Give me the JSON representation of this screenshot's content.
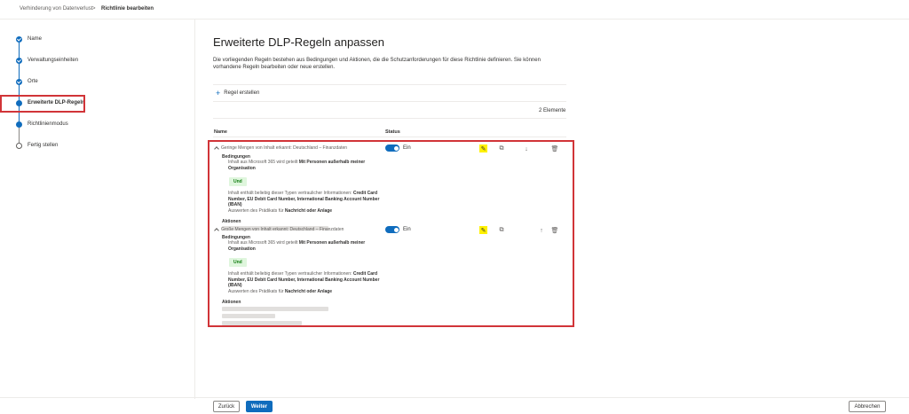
{
  "breadcrumb": {
    "parent": "Verhinderung von Datenverlust",
    "separator": ">",
    "current": "Richtlinie bearbeiten"
  },
  "steps": [
    {
      "label": "Name",
      "state": "done"
    },
    {
      "label": "Verwaltungseinheiten",
      "state": "done"
    },
    {
      "label": "Orte",
      "state": "done"
    },
    {
      "label": "Erweiterte DLP-Regeln",
      "state": "current"
    },
    {
      "label": "Richtlinienmodus",
      "state": "todo"
    },
    {
      "label": "Fertig stellen",
      "state": "todo"
    }
  ],
  "main": {
    "title": "Erweiterte DLP-Regeln anpassen",
    "description": "Die vorliegenden Regeln bestehen aus Bedingungen und Aktionen, die die Schutzanforderungen für diese Richtlinie definieren. Sie können vorhandene Regeln bearbeiten oder neue erstellen.",
    "add_rule": "Regel erstellen",
    "count": "2 Elemente",
    "col_name": "Name",
    "col_status": "Status"
  },
  "rules": [
    {
      "title": "Geringe Mengen von Inhalt erkannt: Deutschland – Finanzdaten",
      "status": "Ein",
      "conditions_label": "Bedingungen",
      "cond1_prefix": "Inhalt aus Microsoft 365 wird geteilt",
      "cond1_bold": "Mit Personen außerhalb meiner Organisation",
      "and_label": "Und",
      "cond2_prefix": "Inhalt enthält beliebig dieser Typen vertraulicher Informationen:",
      "cond2_bold": "Credit Card Number, EU Debit Card Number, International Banking Account Number (IBAN)",
      "cond3_prefix": "Auswerten des Prädikats für",
      "cond3_bold": "Nachricht oder Anlage",
      "actions_label": "Aktionen"
    },
    {
      "title": "Große Mengen von Inhalt erkannt: Deutschland – Finanzdaten",
      "status": "Ein",
      "conditions_label": "Bedingungen",
      "cond1_prefix": "Inhalt aus Microsoft 365 wird geteilt",
      "cond1_bold": "Mit Personen außerhalb meiner Organisation",
      "and_label": "Und",
      "cond2_prefix": "Inhalt enthält beliebig dieser Typen vertraulicher Informationen:",
      "cond2_bold": "Credit Card Number, EU Debit Card Number, International Banking Account Number (IBAN)",
      "cond3_prefix": "Auswerten des Prädikats für",
      "cond3_bold": "Nachricht oder Anlage",
      "actions_label": "Aktionen"
    }
  ],
  "icons": {
    "edit": "pencil-icon",
    "copy": "copy-icon",
    "down": "arrow-down-icon",
    "up": "arrow-up-icon",
    "delete": "trash-icon",
    "add": "plus-icon"
  },
  "colors": {
    "accent": "#0f6cbd",
    "highlight": "#d13438",
    "edit_highlight": "#fff100"
  },
  "footer": {
    "back": "Zurück",
    "next": "Weiter",
    "cancel": "Abbrechen"
  }
}
